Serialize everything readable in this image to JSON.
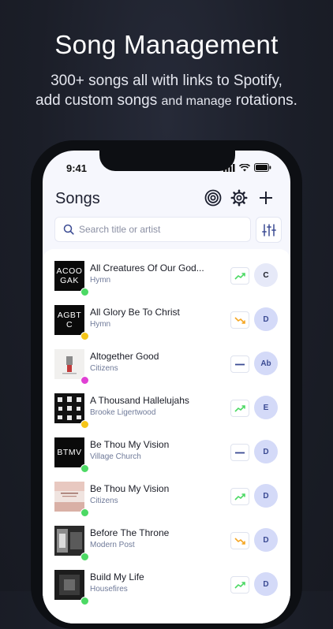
{
  "promo": {
    "headline": "Song Management",
    "line1": "300+ songs all with links to Spotify,",
    "line2_a": "add custom songs",
    "line2_b": "and manage",
    "line2_c": "rotations."
  },
  "status_bar": {
    "time": "9:41"
  },
  "header": {
    "title": "Songs",
    "icons": [
      "rotation-target-icon",
      "gear-icon",
      "plus-icon"
    ]
  },
  "search": {
    "placeholder": "Search title or artist",
    "value": ""
  },
  "filter_icon": "sliders-icon",
  "colors": {
    "green_dot": "#4cd964",
    "yellow_dot": "#f5c518",
    "pink_dot": "#e040d4",
    "trend_up": "#4cd964",
    "trend_down": "#f5a623",
    "trend_flat": "#3b4b93",
    "key_bg": "#d4daf8",
    "key_text": "#3b4b93"
  },
  "songs": [
    {
      "title": "All Creatures Of Our God...",
      "artist": "Hymn",
      "art_text": "ACOO GAK",
      "status": "green",
      "trend": "up",
      "key": "C"
    },
    {
      "title": "All Glory Be To Christ",
      "artist": "Hymn",
      "art_text": "AGBT C",
      "status": "yellow",
      "trend": "down",
      "key": "D"
    },
    {
      "title": "Altogether Good",
      "artist": "Citizens",
      "art_text": "",
      "status": "pink",
      "trend": "flat",
      "key": "Ab"
    },
    {
      "title": "A Thousand Hallelujahs",
      "artist": "Brooke Ligertwood",
      "art_text": "",
      "status": "yellow",
      "trend": "up",
      "key": "E"
    },
    {
      "title": "Be Thou My Vision",
      "artist": "Village Church",
      "art_text": "BTMV",
      "status": "green",
      "trend": "flat",
      "key": "D"
    },
    {
      "title": "Be Thou My Vision",
      "artist": "Citizens",
      "art_text": "",
      "status": "green",
      "trend": "up",
      "key": "D"
    },
    {
      "title": "Before The Throne",
      "artist": "Modern Post",
      "art_text": "",
      "status": "green",
      "trend": "down",
      "key": "D"
    },
    {
      "title": "Build My Life",
      "artist": "Housefires",
      "art_text": "",
      "status": "green",
      "trend": "up",
      "key": "D"
    }
  ]
}
